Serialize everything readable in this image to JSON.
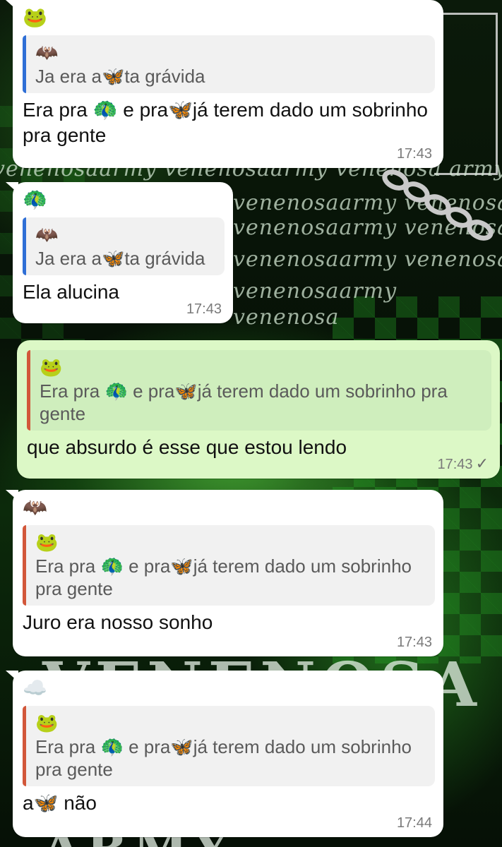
{
  "messages": [
    {
      "sender_icon": "🐸",
      "quote_sender": "🦇",
      "quote_text": "Ja era a🦋ta grávida",
      "text": "Era pra 🦚 e pra🦋já terem dado um sobrinho pra gente",
      "time": "17:43"
    },
    {
      "sender_icon": "🦚",
      "quote_sender": "🦇",
      "quote_text": "Ja era a🦋ta grávida",
      "text": "Ela alucina",
      "time": "17:43"
    },
    {
      "sender_icon": "🐸",
      "quote_text": "Era pra 🦚 e pra🦋já terem dado um sobrinho pra gente",
      "text": "que absurdo é esse que estou lendo",
      "time": "17:43",
      "status": "✓"
    },
    {
      "sender_icon": "🦇",
      "quote_sender": "🐸",
      "quote_text": "Era pra 🦚 e pra🦋já terem dado um sobrinho pra gente",
      "text": "Juro era nosso sonho",
      "time": "17:43"
    },
    {
      "sender_icon": "☁️",
      "quote_sender": "🐸",
      "quote_text": "Era pra 🦚 e pra🦋já terem dado um sobrinho pra gente",
      "text": "a🦋 não",
      "time": "17:44"
    }
  ],
  "wallpaper": {
    "watermark_1": "venenosaarmy venenosaarmy venenosa army",
    "watermark_2": "venenosaarmy  venenosaarmy",
    "watermark_3": "venenosaarmy  venenosa army",
    "watermark_4": "venenosaarmy  venenosa",
    "watermark_5": "venenosaarmy",
    "watermark_6": "venenosa",
    "banner": "VENENOSA",
    "banner_bottom": "ARMY"
  },
  "colors": {
    "incoming_bubble": "#ffffff",
    "outgoing_bubble": "#dcf8c6",
    "quote_bar_blue": "#2f6fd6",
    "quote_bar_orange": "#d2573a",
    "wallpaper_green": "#3fc63a"
  }
}
